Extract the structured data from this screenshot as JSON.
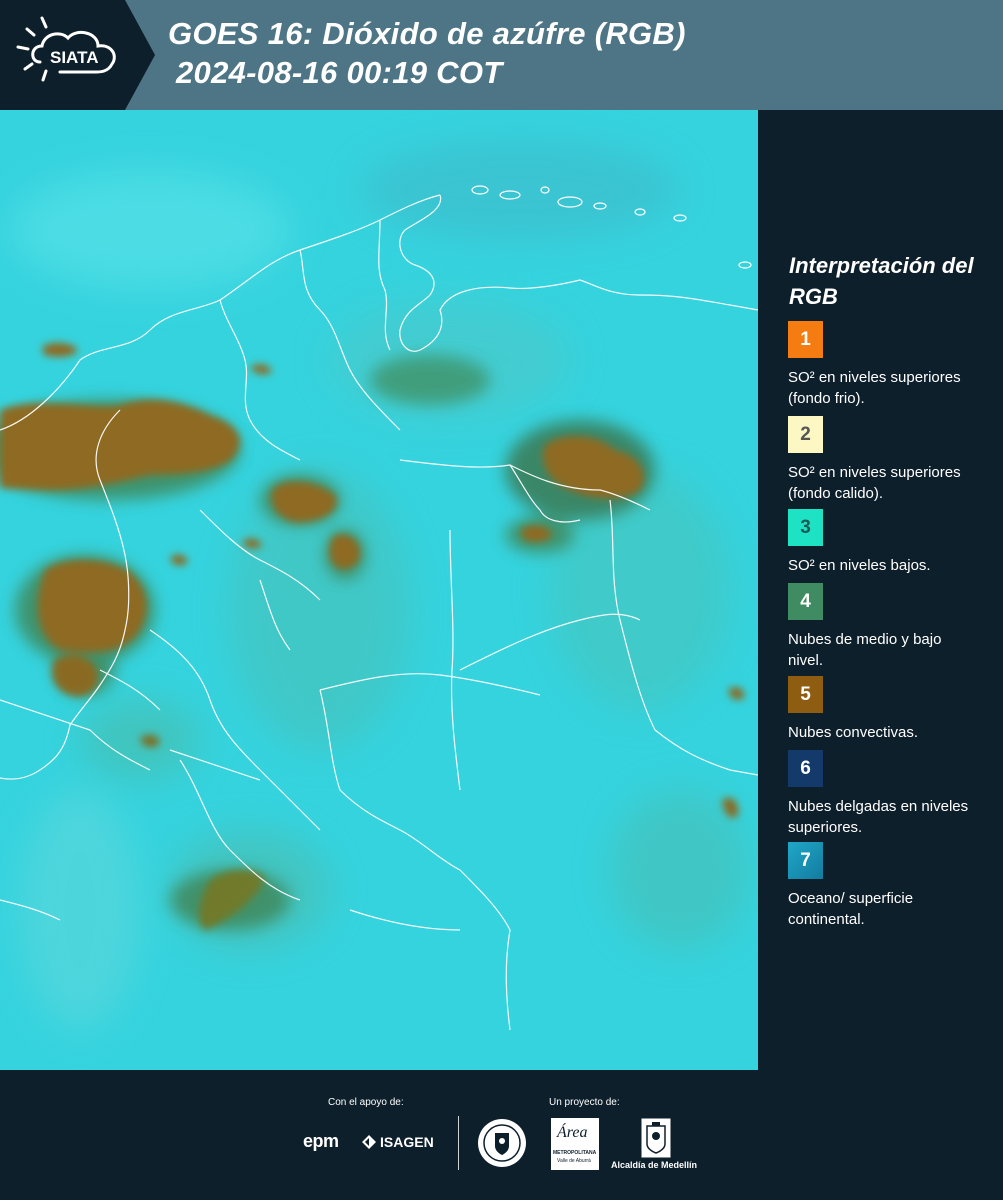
{
  "header": {
    "logo_text": "SIATA",
    "title_line1": "GOES 16: Dióxido de azúfre (RGB)",
    "title_line2": "2024-08-16 00:19 COT"
  },
  "legend": {
    "title": "Interpretación del RGB",
    "items": [
      {
        "num": "1",
        "color": "#f57c10",
        "numColor": "#ffffff",
        "label": "SO² en niveles superiores (fondo frio)."
      },
      {
        "num": "2",
        "color": "#fdf7c3",
        "numColor": "#555555",
        "label": "SO² en niveles superiores (fondo calido)."
      },
      {
        "num": "3",
        "color": "#1de3c4",
        "numColor": "#1b5a55",
        "label": "SO² en niveles bajos."
      },
      {
        "num": "4",
        "color": "#3f8c62",
        "numColor": "#ffffff",
        "label": "Nubes de medio y bajo nivel."
      },
      {
        "num": "5",
        "color": "#8e5d12",
        "numColor": "#ffffff",
        "label": "Nubes convectivas."
      },
      {
        "num": "6",
        "color": "#133a6b",
        "numColor": "#ffffff",
        "label": "Nubes delgadas en niveles superiores."
      },
      {
        "num": "7",
        "color": "#1996b9",
        "numColor": "#ffffff",
        "label": "Oceano/ superficie continental."
      }
    ]
  },
  "footer": {
    "support_label": "Con el apoyo de:",
    "project_label": "Un proyecto de:",
    "epm": "epm",
    "isagen": "ISAGEN",
    "area_metro": "Área",
    "area_metro_sub": "METROPOLITANA",
    "area_metro_sub2": "Valle de Aburrá",
    "alcaldia": "Alcaldía de Medellín"
  },
  "colors": {
    "header_bg": "#4e7585",
    "dark_bg": "#0e1f2c",
    "map_base": "#33d2dd"
  }
}
